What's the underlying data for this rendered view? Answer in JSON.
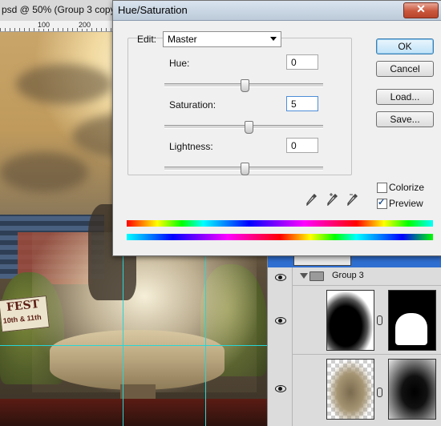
{
  "document": {
    "title": "psd @ 50% (Group 3 copy,",
    "ruler_labels": [
      "100",
      "200"
    ],
    "sign_line1": "FEST",
    "sign_line2": "10th & 11th"
  },
  "dialog": {
    "title": "Hue/Saturation",
    "close_glyph": "✕",
    "edit_label": "Edit:",
    "edit_value": "Master",
    "hue_label": "Hue:",
    "hue_value": "0",
    "saturation_label": "Saturation:",
    "saturation_value": "5",
    "lightness_label": "Lightness:",
    "lightness_value": "0",
    "ok": "OK",
    "cancel": "Cancel",
    "load": "Load...",
    "save": "Save...",
    "colorize_label": "Colorize",
    "colorize_checked": false,
    "preview_label": "Preview",
    "preview_checked": true,
    "eyedropper_icons": [
      "eyedropper-icon",
      "eyedropper-plus-icon",
      "eyedropper-minus-icon"
    ]
  },
  "layers": {
    "group_name": "Group 3",
    "icons": [
      "eye-icon",
      "folder-icon",
      "chain-link-icon"
    ]
  }
}
